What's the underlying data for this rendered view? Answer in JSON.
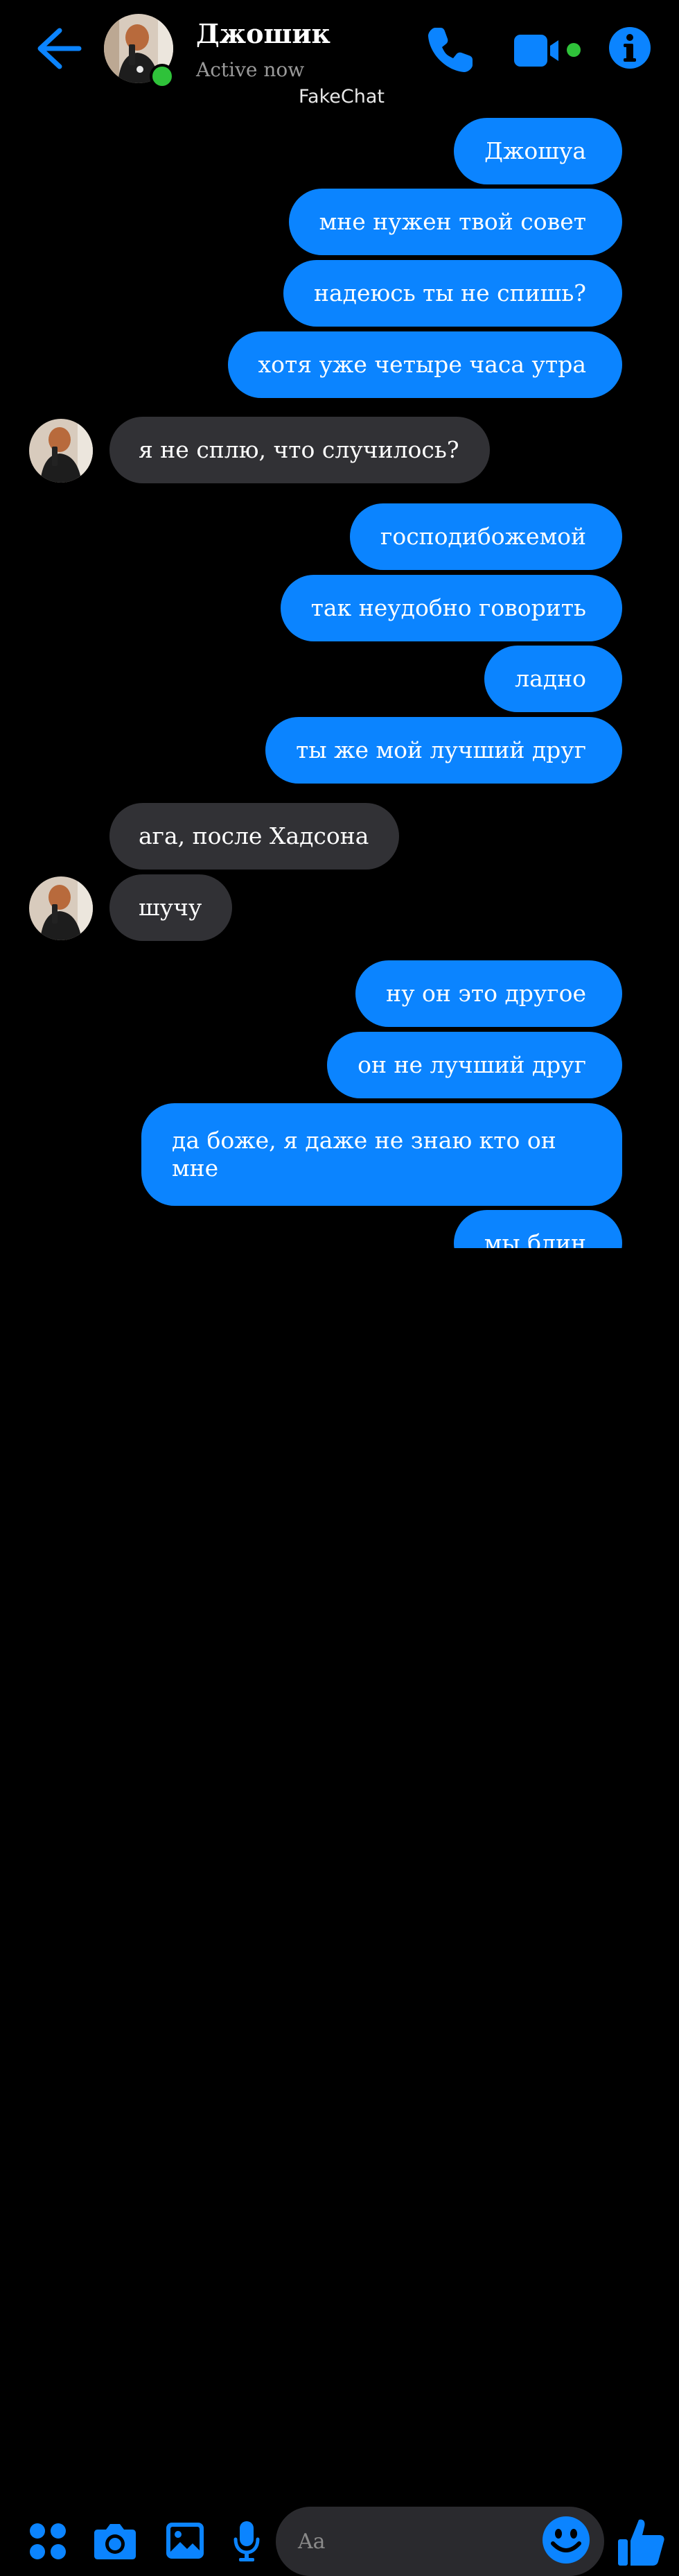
{
  "header": {
    "contact_name": "Джошик",
    "status": "Active now",
    "watermark": "FakeChat"
  },
  "colors": {
    "accent": "#0b84ff",
    "incoming_bubble": "#313135",
    "background": "#000000",
    "online": "#2fc23a"
  },
  "icons": {
    "back": "arrow-left-icon",
    "call": "phone-icon",
    "video": "video-camera-icon",
    "info": "info-icon",
    "apps": "four-dots-icon",
    "camera": "camera-icon",
    "gallery": "image-icon",
    "mic": "microphone-icon",
    "emoji": "smile-icon",
    "like": "thumbs-up-icon"
  },
  "messages": [
    {
      "from": "me",
      "text": "Джошуа"
    },
    {
      "from": "me",
      "text": "мне нужен твой совет"
    },
    {
      "from": "me",
      "text": "надеюсь ты не спишь?"
    },
    {
      "from": "me",
      "text": "хотя уже четыре часа утра"
    },
    {
      "from": "contact",
      "text": "я не сплю, что случилось?"
    },
    {
      "from": "me",
      "text": "господибожемой"
    },
    {
      "from": "me",
      "text": "так неудобно говорить"
    },
    {
      "from": "me",
      "text": "ладно"
    },
    {
      "from": "me",
      "text": "ты же мой лучший друг"
    },
    {
      "from": "contact",
      "text": "ага, после Хадсона"
    },
    {
      "from": "contact",
      "text": "шучу"
    },
    {
      "from": "me",
      "text": "ну он это другое"
    },
    {
      "from": "me",
      "text": "он не лучший друг"
    },
    {
      "from": "me",
      "text": "да боже, я даже не знаю кто он мне"
    },
    {
      "from": "me",
      "text": "мы блин"
    }
  ],
  "composer": {
    "placeholder": "Aa"
  }
}
